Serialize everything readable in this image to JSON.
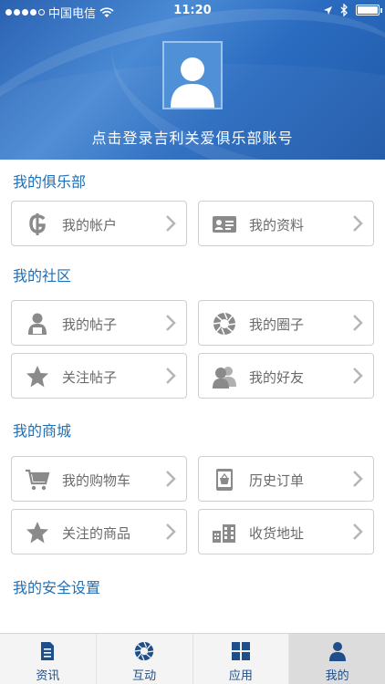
{
  "status_bar": {
    "carrier": "中国电信",
    "time": "11:20"
  },
  "header": {
    "login_prompt": "点击登录吉利关爱俱乐部账号"
  },
  "sections": [
    {
      "title": "我的俱乐部",
      "items": [
        {
          "label": "我的帐户",
          "icon": "dollar-icon"
        },
        {
          "label": "我的资料",
          "icon": "id-card-icon"
        }
      ]
    },
    {
      "title": "我的社区",
      "items": [
        {
          "label": "我的帖子",
          "icon": "user-post-icon"
        },
        {
          "label": "我的圈子",
          "icon": "aperture-icon"
        },
        {
          "label": "关注帖子",
          "icon": "star-icon"
        },
        {
          "label": "我的好友",
          "icon": "friends-icon"
        }
      ]
    },
    {
      "title": "我的商城",
      "items": [
        {
          "label": "我的购物车",
          "icon": "cart-icon"
        },
        {
          "label": "历史订单",
          "icon": "mobile-basket-icon"
        },
        {
          "label": "关注的商品",
          "icon": "star-icon"
        },
        {
          "label": "收货地址",
          "icon": "buildings-icon"
        }
      ]
    },
    {
      "title": "我的安全设置",
      "items": []
    }
  ],
  "tabs": [
    {
      "label": "资讯",
      "icon": "document-icon",
      "active": false
    },
    {
      "label": "互动",
      "icon": "aperture-icon",
      "active": false
    },
    {
      "label": "应用",
      "icon": "grid-icon",
      "active": false
    },
    {
      "label": "我的",
      "icon": "person-icon",
      "active": true
    }
  ],
  "colors": {
    "accent": "#1f6fb5",
    "header_blue": "#2a62b2",
    "icon_gray": "#8a8a8a"
  }
}
